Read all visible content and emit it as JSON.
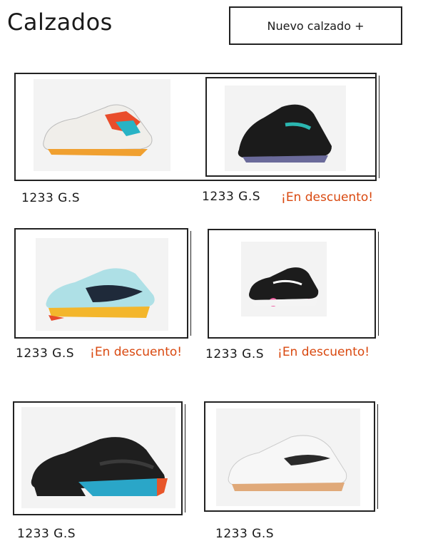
{
  "header": {
    "title": "Calzados",
    "new_button_label": "Nuevo calzado +"
  },
  "products": [
    {
      "price": "1233 G.S",
      "discount": ""
    },
    {
      "price": "1233 G.S",
      "discount": "¡En descuento!"
    },
    {
      "price": "1233 G.S",
      "discount": "¡En descuento!"
    },
    {
      "price": "1233 G.S",
      "discount": "¡En descuento!"
    },
    {
      "price": "1233 G.S",
      "discount": ""
    },
    {
      "price": "1233 G.S",
      "discount": ""
    }
  ],
  "colors": {
    "discount": "#d9480f",
    "border": "#222222"
  }
}
